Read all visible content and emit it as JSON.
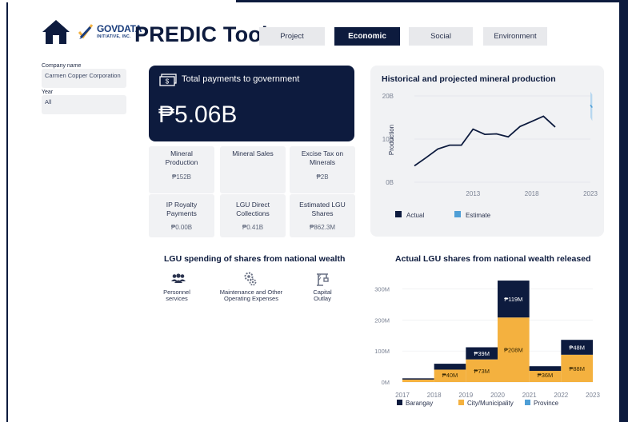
{
  "app": {
    "title": "PREDIC Tool",
    "logo_main": "GOVDATA",
    "logo_sub": "INITIATIVE, INC."
  },
  "nav": [
    {
      "label": "Project",
      "active": false
    },
    {
      "label": "Economic",
      "active": true
    },
    {
      "label": "Social",
      "active": false
    },
    {
      "label": "Environment",
      "active": false
    }
  ],
  "filters": {
    "company_label": "Company name",
    "company_value": "Carmen Copper Corporation",
    "year_label": "Year",
    "year_value": "All"
  },
  "total": {
    "label": "Total payments to government",
    "value": "₱5.06B"
  },
  "metrics": [
    {
      "label_lines": [
        "Mineral",
        "Production"
      ],
      "value": "₱152B"
    },
    {
      "label_lines": [
        "Mineral Sales"
      ],
      "value": ""
    },
    {
      "label_lines": [
        "Excise Tax on",
        "Minerals"
      ],
      "value": "₱2B"
    },
    {
      "label_lines": [
        "IP Royalty",
        "Payments"
      ],
      "value": "₱0.00B"
    },
    {
      "label_lines": [
        "LGU Direct",
        "Collections"
      ],
      "value": "₱0.41B"
    },
    {
      "label_lines": [
        "Estimated LGU",
        "Shares"
      ],
      "value": "₱862.3M"
    }
  ],
  "spending": {
    "title": "LGU spending of shares from national wealth",
    "items": [
      {
        "label_lines": [
          "Personnel",
          "services"
        ],
        "icon": "people-icon"
      },
      {
        "label_lines": [
          "Maintenance and Other",
          "Operating Expenses"
        ],
        "icon": "gears-icon"
      },
      {
        "label_lines": [
          "Capital",
          "Outlay"
        ],
        "icon": "crane-icon"
      }
    ]
  },
  "colors": {
    "navy": "#0d1b3e",
    "estimate_blue": "#4f9fd6",
    "orange": "#f4b13f",
    "province_blue": "#4f9fd6"
  },
  "chart_data": [
    {
      "type": "line",
      "title": "Historical and projected mineral production",
      "ylabel": "Production",
      "ylim": [
        0,
        20
      ],
      "y_ticks": [
        "0B",
        "10B",
        "20B"
      ],
      "x_ticks": [
        "2013",
        "2018",
        "2023"
      ],
      "xlim": [
        2008,
        2023
      ],
      "series": [
        {
          "name": "Actual",
          "x": [
            2008,
            2009,
            2010,
            2011,
            2012,
            2013,
            2014,
            2015,
            2016,
            2017,
            2018,
            2019,
            2020,
            2021
          ],
          "y": [
            3.8,
            5.7,
            7.7,
            8.6,
            8.6,
            12.3,
            11.1,
            11.2,
            10.5,
            12.9,
            14.1,
            15.3,
            12.8,
            null
          ]
        },
        {
          "name": "Estimate",
          "x": [
            2022,
            2023
          ],
          "y": [
            17.3,
            17.9
          ],
          "band_low": [
            14.2,
            15.0
          ],
          "band_high": [
            20.3,
            21.0
          ]
        }
      ],
      "legend": "bottom"
    },
    {
      "type": "bar",
      "title": "Actual LGU shares from national wealth released",
      "y_ticks": [
        "0M",
        "100M",
        "200M",
        "300M"
      ],
      "ylim": [
        0,
        340
      ],
      "x_ticks": [
        "2017",
        "2018",
        "2019",
        "2020",
        "2021",
        "2022",
        "2023"
      ],
      "categories": [
        "2017",
        "2018",
        "2019",
        "2020",
        "2021",
        "2022"
      ],
      "stacked": true,
      "series": [
        {
          "name": "City/Municipality",
          "values": [
            8,
            40,
            73,
            208,
            36,
            88
          ],
          "labels": [
            "",
            "₱40M",
            "₱73M",
            "₱208M",
            "₱36M",
            "₱88M"
          ]
        },
        {
          "name": "Barangay",
          "values": [
            4,
            19,
            39,
            119,
            15,
            48
          ],
          "labels": [
            "",
            "",
            "₱39M",
            "₱119M",
            "",
            "₱48M"
          ]
        },
        {
          "name": "Province",
          "values": [
            0,
            0,
            0,
            0,
            0,
            0
          ],
          "labels": [
            "",
            "",
            "",
            "",
            "",
            ""
          ]
        }
      ],
      "legend_order": [
        "Barangay",
        "City/Municipality",
        "Province"
      ],
      "legend": "bottom"
    }
  ]
}
